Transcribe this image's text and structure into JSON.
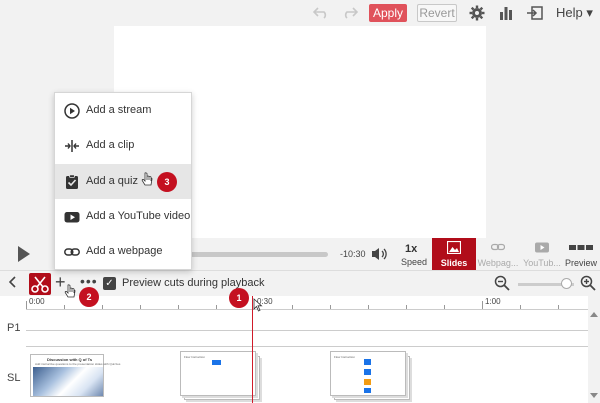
{
  "toolbar": {
    "undo_icon": "undo-icon",
    "redo_icon": "redo-icon",
    "apply_label": "Apply",
    "revert_label": "Revert",
    "settings_icon": "gear-icon",
    "stats_icon": "bar-chart-icon",
    "exit_icon": "exit-icon",
    "help_label": "Help ▾",
    "accent": "#e0525b"
  },
  "player": {
    "duration": "-10:30",
    "speed_value": "1x",
    "speed_label": "Speed",
    "buttons": [
      {
        "label": "Slides",
        "active": true
      },
      {
        "label": "Webpag...",
        "active": false
      },
      {
        "label": "YouTub...",
        "active": false
      },
      {
        "label": "Preview",
        "active": false
      }
    ]
  },
  "timeline_bar": {
    "checkbox_checked": true,
    "checkbox_label": "Preview cuts during playback"
  },
  "ruler": {
    "labels": [
      "0:00",
      "0:30",
      "1:00"
    ]
  },
  "tracks": [
    "P1",
    "SL"
  ],
  "slides": {
    "first_title": "Discussion with Q of Ts",
    "first_subtitle": "Add instructive questions to the presentation slides with Quizzes",
    "other_title": "Flow Instruction"
  },
  "add_menu": {
    "items": [
      {
        "label": "Add a stream",
        "icon": "play-circle-icon"
      },
      {
        "label": "Add a clip",
        "icon": "clip-icon"
      },
      {
        "label": "Add a quiz",
        "icon": "quiz-icon",
        "highlighted": true
      },
      {
        "label": "Add a YouTube video",
        "icon": "youtube-icon"
      },
      {
        "label": "Add a webpage",
        "icon": "link-icon"
      }
    ]
  },
  "badges": [
    "1",
    "2",
    "3"
  ],
  "colors": {
    "brand_red": "#b10d1a",
    "badge_red": "#c41020",
    "playhead": "#d01b2a"
  }
}
